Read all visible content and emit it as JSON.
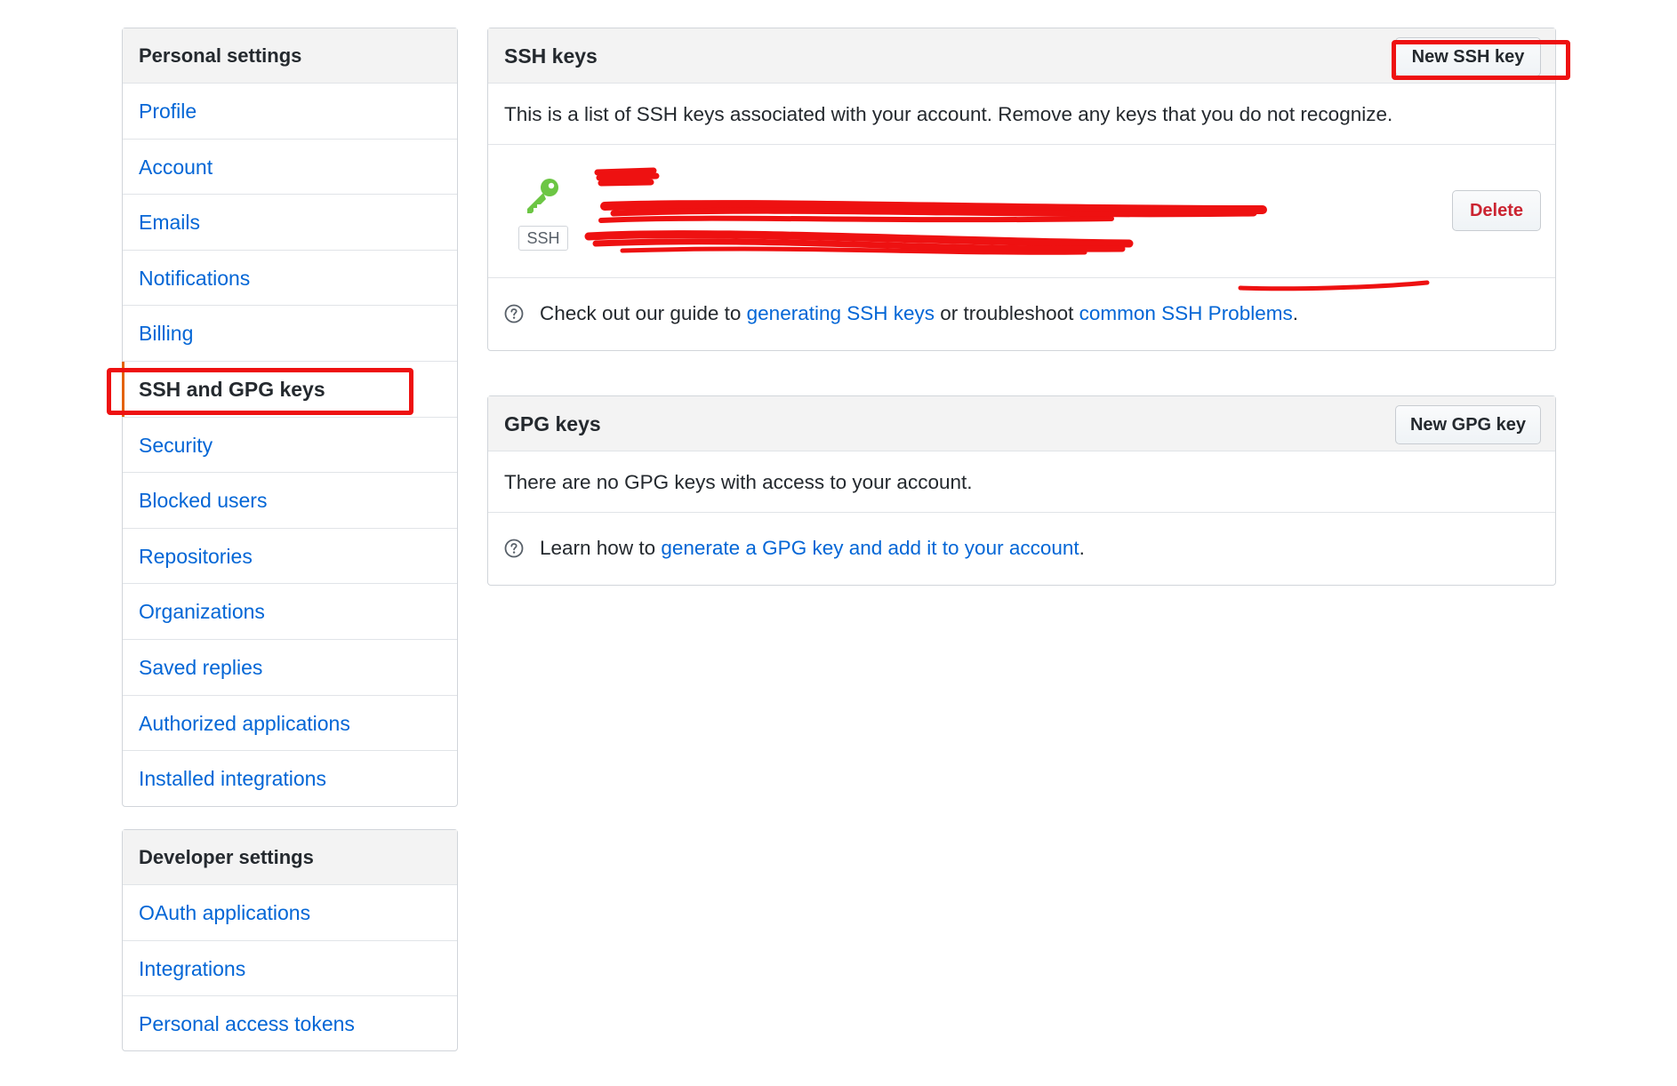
{
  "personal_settings": {
    "heading": "Personal settings",
    "items": [
      {
        "label": "Profile"
      },
      {
        "label": "Account"
      },
      {
        "label": "Emails"
      },
      {
        "label": "Notifications"
      },
      {
        "label": "Billing"
      },
      {
        "label": "SSH and GPG keys",
        "selected": true
      },
      {
        "label": "Security"
      },
      {
        "label": "Blocked users"
      },
      {
        "label": "Repositories"
      },
      {
        "label": "Organizations"
      },
      {
        "label": "Saved replies"
      },
      {
        "label": "Authorized applications"
      },
      {
        "label": "Installed integrations"
      }
    ]
  },
  "developer_settings": {
    "heading": "Developer settings",
    "items": [
      {
        "label": "OAuth applications"
      },
      {
        "label": "Integrations"
      },
      {
        "label": "Personal access tokens"
      }
    ]
  },
  "ssh_keys": {
    "title": "SSH keys",
    "new_button": "New SSH key",
    "intro": "This is a list of SSH keys associated with your account. Remove any keys that you do not recognize.",
    "key": {
      "badge": "SSH",
      "title": "b",
      "delete_button": "Delete",
      "icon": "key-icon",
      "icon_color": "#6cc644"
    },
    "help": {
      "prefix": "Check out our guide to ",
      "link1": "generating SSH keys",
      "middle": " or troubleshoot ",
      "link2": "common SSH Problems",
      "suffix": "."
    }
  },
  "gpg_keys": {
    "title": "GPG keys",
    "new_button": "New GPG key",
    "empty": "There are no GPG keys with access to your account.",
    "help": {
      "prefix": "Learn how to ",
      "link": "generate a GPG key and add it to your account",
      "suffix": "."
    }
  },
  "colors": {
    "link": "#0366d6",
    "selected_marker": "#e36209",
    "annotation_red": "#ee1111",
    "danger": "#cb2431"
  }
}
